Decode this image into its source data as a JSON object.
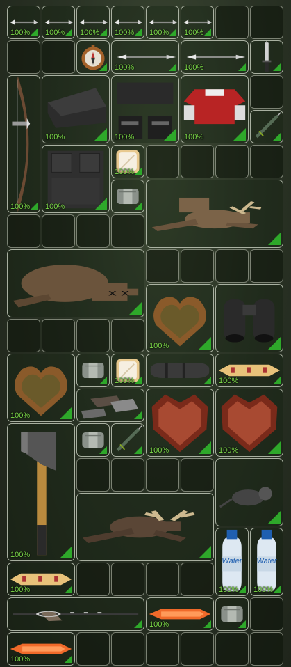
{
  "inventory": {
    "quality_color": "#2ea82a",
    "items": [
      {
        "name": "arrow-icon",
        "quality": "100%"
      },
      {
        "name": "arrow-icon",
        "quality": "100%"
      },
      {
        "name": "arrow-icon",
        "quality": "100%"
      },
      {
        "name": "arrow-icon",
        "quality": "100%"
      },
      {
        "name": "arrow-icon",
        "quality": "100%"
      },
      {
        "name": "arrow-icon",
        "quality": "100%"
      },
      {
        "name": "compass-icon",
        "quality": ""
      },
      {
        "name": "arrow-icon",
        "quality": "100%"
      },
      {
        "name": "arrow-icon",
        "quality": "100%"
      },
      {
        "name": "knife-icon",
        "quality": ""
      },
      {
        "name": "bow-icon",
        "quality": "100%"
      },
      {
        "name": "black-cap-icon",
        "quality": "100%"
      },
      {
        "name": "black-pants-icon",
        "quality": "100%"
      },
      {
        "name": "red-shirt-icon",
        "quality": "100%"
      },
      {
        "name": "syringe-icon",
        "quality": ""
      },
      {
        "name": "vest-icon",
        "quality": "100%"
      },
      {
        "name": "sandwich-icon",
        "quality": "100%"
      },
      {
        "name": "bandage-icon",
        "quality": ""
      },
      {
        "name": "deer-carcass-icon",
        "quality": ""
      },
      {
        "name": "bear-carcass-icon",
        "quality": ""
      },
      {
        "name": "raw-meat-icon",
        "quality": "100%"
      },
      {
        "name": "binoculars-icon",
        "quality": ""
      },
      {
        "name": "raw-meat-icon",
        "quality": "100%"
      },
      {
        "name": "bandage-icon",
        "quality": ""
      },
      {
        "name": "sandwich-icon",
        "quality": "100%"
      },
      {
        "name": "sleeping-bag-icon",
        "quality": ""
      },
      {
        "name": "bread-icon",
        "quality": "100%"
      },
      {
        "name": "metal-scraps-icon",
        "quality": ""
      },
      {
        "name": "red-meat-icon",
        "quality": "100%"
      },
      {
        "name": "red-meat-icon",
        "quality": "100%"
      },
      {
        "name": "axe-icon",
        "quality": "100%"
      },
      {
        "name": "bandage-icon",
        "quality": ""
      },
      {
        "name": "syringe-icon",
        "quality": ""
      },
      {
        "name": "rat-icon",
        "quality": ""
      },
      {
        "name": "moose-carcass-icon",
        "quality": ""
      },
      {
        "name": "water-bottle-icon",
        "quality": "100%",
        "label": "Water"
      },
      {
        "name": "water-bottle-icon",
        "quality": "100%",
        "label": "Water"
      },
      {
        "name": "bread-icon",
        "quality": "100%"
      },
      {
        "name": "rifle-icon",
        "quality": ""
      },
      {
        "name": "cooked-fish-icon",
        "quality": "100%"
      },
      {
        "name": "bandage-icon",
        "quality": ""
      },
      {
        "name": "cooked-fish-icon",
        "quality": "100%"
      }
    ]
  }
}
